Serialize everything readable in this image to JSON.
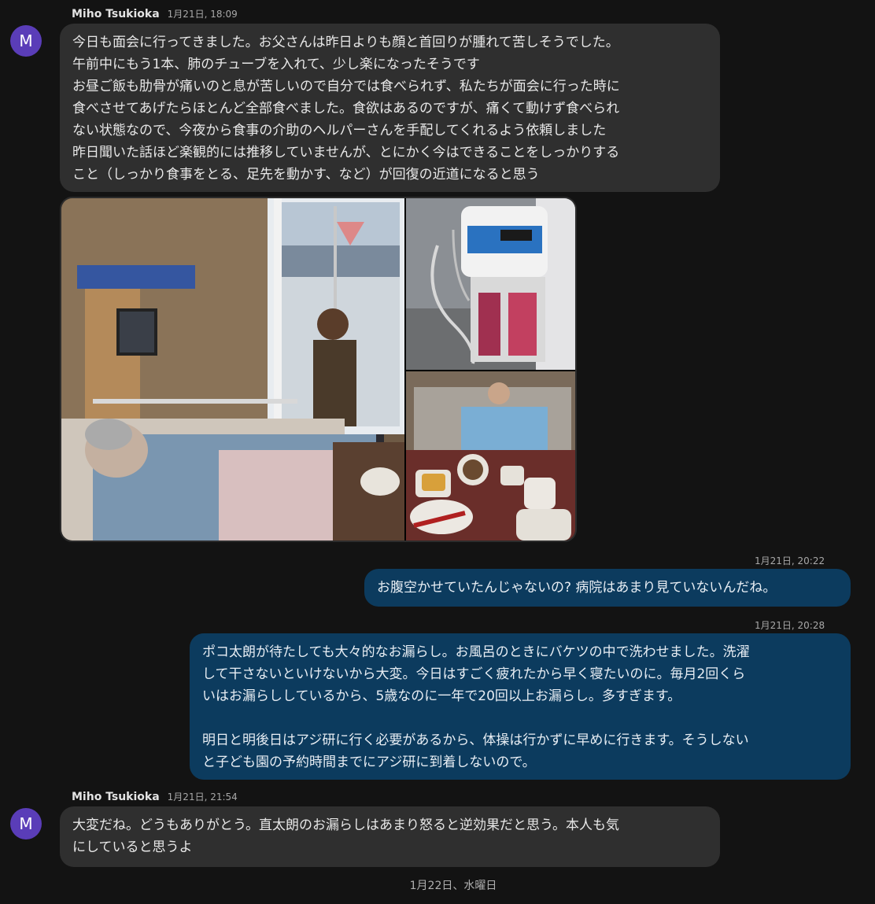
{
  "messages": [
    {
      "sender": "Miho Tsukioka",
      "time": "1月21日, 18:09",
      "avatar": "M",
      "text": "今日も面会に行ってきました。お父さんは昨日よりも顔と首回りが腫れて苦しそうでした。\n午前中にもう1本、肺のチューブを入れて、少し楽になったそうです\nお昼ご飯も肋骨が痛いのと息が苦しいので自分では食べられず、私たちが面会に行った時に\n食べさせてあげたらほとんど全部食べました。食欲はあるのですが、痛くて動けず食べられ\nない状態なので、今夜から食事の介助のヘルパーさんを手配してくれるよう依頼しました\n昨日聞いた話ほど楽観的には推移していませんが、とにかく今はできることをしっかりする\nこと（しっかり食事をとる、足先を動かす、など）が回復の近道になると思う"
    },
    {
      "time": "1月21日, 20:22",
      "text": "お腹空かせていたんじゃないの? 病院はあまり見ていないんだね。"
    },
    {
      "time": "1月21日, 20:28",
      "text": "ポコ太朗が待たしても大々的なお漏らし。お風呂のときにバケツの中で洗わせました。洗濯\nして干さないといけないから大変。今日はすごく疲れたから早く寝たいのに。毎月2回くら\nいはお漏らししているから、5歳なのに一年で20回以上お漏らし。多すぎます。\n\n明日と明後日はアジ研に行く必要があるから、体操は行かずに早めに行きます。そうしない\nと子ども園の予約時間までにアジ研に到着しないので。"
    },
    {
      "sender": "Miho Tsukioka",
      "time": "1月21日, 21:54",
      "avatar": "M",
      "text": "大変だね。どうもありがとう。直太朗のお漏らしはあまり怒ると逆効果だと思う。本人も気\nにしていると思うよ"
    }
  ],
  "date_divider": "1月22日、水曜日",
  "colors": {
    "background": "#131313",
    "incoming_bubble": "#2f2f2f",
    "outgoing_bubble": "#0c3b5e",
    "avatar": "#5a3db8"
  }
}
